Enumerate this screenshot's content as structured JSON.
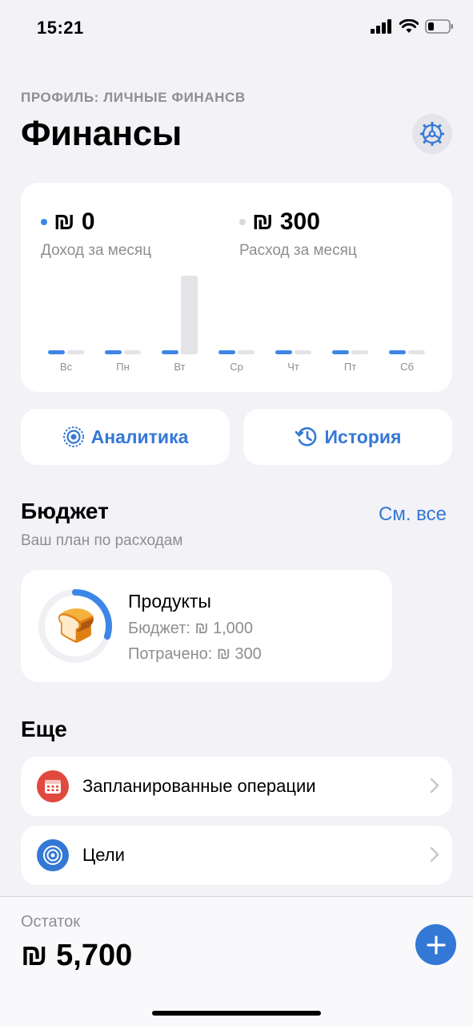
{
  "status_bar": {
    "time": "15:21"
  },
  "header": {
    "profile_label": "ПРОФИЛЬ: ЛИЧНЫЕ ФИНАНСВ",
    "title": "Финансы",
    "settings_icon": "gear-icon"
  },
  "summary": {
    "income_value": "₪ 0",
    "income_label": "Доход за месяц",
    "expense_value": "₪ 300",
    "expense_label": "Расход за месяц",
    "income_color": "#3d86e6",
    "expense_color": "#e3e3e8"
  },
  "chart_data": {
    "type": "bar",
    "categories": [
      "Вс",
      "Пн",
      "Вт",
      "Ср",
      "Чт",
      "Пт",
      "Сб"
    ],
    "series": [
      {
        "name": "Доход",
        "values": [
          0,
          0,
          0,
          0,
          0,
          0,
          0
        ],
        "color": "#3d86e6"
      },
      {
        "name": "Расход",
        "values": [
          0,
          0,
          300,
          0,
          0,
          0,
          0
        ],
        "color": "#e3e3e8"
      }
    ],
    "ylim": [
      0,
      300
    ]
  },
  "actions": {
    "analytics_label": "Аналитика",
    "analytics_icon": "target-icon",
    "history_label": "История",
    "history_icon": "history-clock-icon"
  },
  "budget": {
    "title": "Бюджет",
    "see_all": "См. все",
    "subtitle": "Ваш план по расходам",
    "items": [
      {
        "emoji": "🍞",
        "name": "Продукты",
        "budget_line": "Бюджет: ₪ 1,000",
        "spent_line": "Потрачено: ₪ 300",
        "progress": 0.3
      }
    ]
  },
  "more": {
    "title": "Еще",
    "items": [
      {
        "label": "Запланированные операции",
        "icon": "calendar-icon",
        "color": "#e0493e"
      },
      {
        "label": "Цели",
        "icon": "target-icon",
        "color": "#3478d6"
      }
    ]
  },
  "footer": {
    "balance_label": "Остаток",
    "balance_value": "₪ 5,700",
    "add_icon": "plus-icon"
  },
  "accent_color": "#3478d6"
}
